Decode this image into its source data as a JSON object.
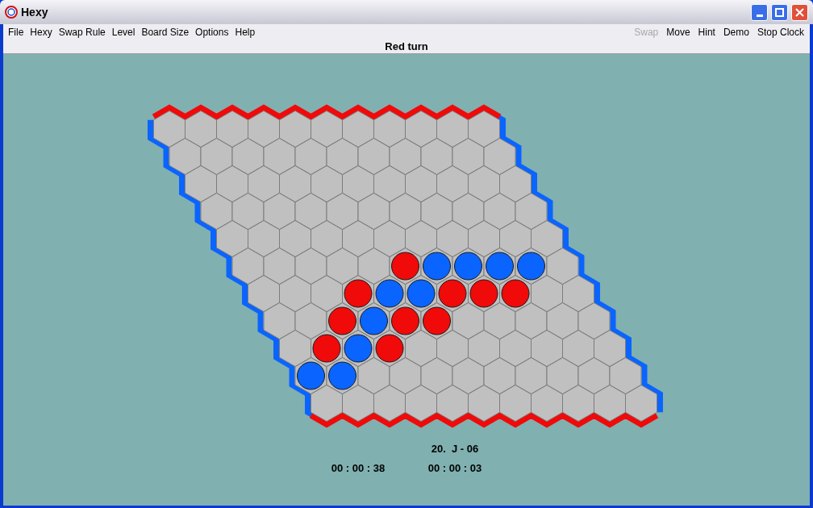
{
  "window": {
    "title": "Hexy"
  },
  "menu": [
    {
      "label": "File"
    },
    {
      "label": "Hexy"
    },
    {
      "label": "Swap Rule"
    },
    {
      "label": "Level"
    },
    {
      "label": "Board Size"
    },
    {
      "label": "Options"
    },
    {
      "label": "Help"
    }
  ],
  "toolbar": [
    {
      "label": "Swap",
      "disabled": true
    },
    {
      "label": "Move",
      "disabled": false
    },
    {
      "label": "Hint",
      "disabled": false
    },
    {
      "label": "Demo",
      "disabled": false
    },
    {
      "label": "Stop Clock",
      "disabled": false
    }
  ],
  "status": "Red turn",
  "board": {
    "rows": [
      [
        {
          "kind": "empty"
        },
        {
          "kind": "empty"
        },
        {
          "kind": "empty"
        },
        {
          "kind": "empty"
        },
        {
          "kind": "empty"
        },
        {
          "kind": "empty"
        },
        {
          "kind": "empty"
        },
        {
          "kind": "empty"
        },
        {
          "kind": "empty"
        },
        {
          "kind": "empty"
        },
        {
          "kind": "empty"
        }
      ],
      [
        {
          "kind": "empty"
        },
        {
          "kind": "empty"
        },
        {
          "kind": "empty"
        },
        {
          "kind": "empty"
        },
        {
          "kind": "empty"
        },
        {
          "kind": "empty"
        },
        {
          "kind": "empty"
        },
        {
          "kind": "empty"
        },
        {
          "kind": "empty"
        },
        {
          "kind": "empty"
        },
        {
          "kind": "empty"
        }
      ],
      [
        {
          "kind": "empty"
        },
        {
          "kind": "empty"
        },
        {
          "kind": "empty"
        },
        {
          "kind": "empty"
        },
        {
          "kind": "empty"
        },
        {
          "kind": "empty"
        },
        {
          "kind": "empty"
        },
        {
          "kind": "empty"
        },
        {
          "kind": "empty"
        },
        {
          "kind": "empty"
        },
        {
          "kind": "empty"
        }
      ],
      [
        {
          "kind": "empty"
        },
        {
          "kind": "empty"
        },
        {
          "kind": "empty"
        },
        {
          "kind": "empty"
        },
        {
          "kind": "empty"
        },
        {
          "kind": "empty"
        },
        {
          "kind": "empty"
        },
        {
          "kind": "empty"
        },
        {
          "kind": "empty"
        },
        {
          "kind": "empty"
        },
        {
          "kind": "empty"
        }
      ],
      [
        {
          "kind": "empty"
        },
        {
          "kind": "empty"
        },
        {
          "kind": "empty"
        },
        {
          "kind": "empty"
        },
        {
          "kind": "empty"
        },
        {
          "kind": "empty"
        },
        {
          "kind": "empty"
        },
        {
          "kind": "empty"
        },
        {
          "kind": "empty"
        },
        {
          "kind": "empty"
        },
        {
          "kind": "empty"
        }
      ],
      [
        {
          "kind": "empty"
        },
        {
          "kind": "empty"
        },
        {
          "kind": "empty"
        },
        {
          "kind": "empty"
        },
        {
          "kind": "empty"
        },
        {
          "kind": "red"
        },
        {
          "kind": "blue"
        },
        {
          "kind": "blue"
        },
        {
          "kind": "blue"
        },
        {
          "kind": "blue"
        },
        {
          "kind": "empty"
        }
      ],
      [
        {
          "kind": "empty"
        },
        {
          "kind": "empty"
        },
        {
          "kind": "empty"
        },
        {
          "kind": "red"
        },
        {
          "kind": "blue"
        },
        {
          "kind": "blue"
        },
        {
          "kind": "red"
        },
        {
          "kind": "red"
        },
        {
          "kind": "red"
        },
        {
          "kind": "empty"
        },
        {
          "kind": "empty"
        }
      ],
      [
        {
          "kind": "empty"
        },
        {
          "kind": "empty"
        },
        {
          "kind": "red"
        },
        {
          "kind": "blue"
        },
        {
          "kind": "red"
        },
        {
          "kind": "red"
        },
        {
          "kind": "empty"
        },
        {
          "kind": "empty"
        },
        {
          "kind": "empty"
        },
        {
          "kind": "empty"
        },
        {
          "kind": "empty"
        }
      ],
      [
        {
          "kind": "empty"
        },
        {
          "kind": "red"
        },
        {
          "kind": "blue"
        },
        {
          "kind": "red"
        },
        {
          "kind": "empty"
        },
        {
          "kind": "empty"
        },
        {
          "kind": "empty"
        },
        {
          "kind": "empty"
        },
        {
          "kind": "empty"
        },
        {
          "kind": "empty"
        },
        {
          "kind": "empty"
        }
      ],
      [
        {
          "kind": "blue"
        },
        {
          "kind": "blue"
        },
        {
          "kind": "empty"
        },
        {
          "kind": "empty"
        },
        {
          "kind": "empty"
        },
        {
          "kind": "empty"
        },
        {
          "kind": "empty"
        },
        {
          "kind": "empty"
        },
        {
          "kind": "empty"
        },
        {
          "kind": "empty"
        },
        {
          "kind": "empty"
        }
      ],
      [
        {
          "kind": "empty"
        },
        {
          "kind": "empty"
        },
        {
          "kind": "empty"
        },
        {
          "kind": "empty"
        },
        {
          "kind": "empty"
        },
        {
          "kind": "empty"
        },
        {
          "kind": "empty"
        },
        {
          "kind": "empty"
        },
        {
          "kind": "empty"
        },
        {
          "kind": "empty"
        },
        {
          "kind": "empty"
        }
      ]
    ]
  },
  "last_move": "20.  J - 06",
  "clocks": [
    "00 : 00 : 38",
    "00 : 00 : 03"
  ]
}
